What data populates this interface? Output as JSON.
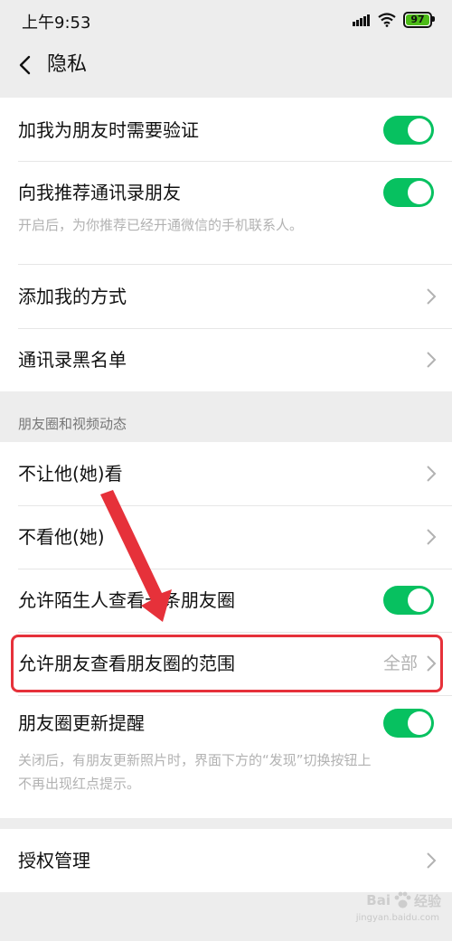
{
  "status_bar": {
    "time": "上午9:53",
    "battery": "97"
  },
  "nav": {
    "title": "隐私"
  },
  "group1": {
    "verify": {
      "label": "加我为朋友时需要验证"
    },
    "recommend": {
      "label": "向我推荐通讯录朋友",
      "desc": "开启后，为你推荐已经开通微信的手机联系人。"
    },
    "add_methods": {
      "label": "添加我的方式"
    },
    "blacklist": {
      "label": "通讯录黑名单"
    }
  },
  "moments_section": {
    "header": "朋友圈和视频动态",
    "hide_from": {
      "label": "不让他(她)看"
    },
    "dont_see": {
      "label": "不看他(她)"
    },
    "strangers": {
      "label": "允许陌生人查看十条朋友圈"
    },
    "range": {
      "label": "允许朋友查看朋友圈的范围",
      "value": "全部"
    },
    "update_reminder": {
      "label": "朋友圈更新提醒",
      "desc_line1": "关闭后，有朋友更新照片时，界面下方的“发现”切换按钮上",
      "desc_line2": "不再出现红点提示。"
    }
  },
  "group3": {
    "auth": {
      "label": "授权管理"
    }
  },
  "watermark": {
    "brand": "Bai",
    "brand2": "经验",
    "sub": "jingyan.baidu.com"
  },
  "colors": {
    "toggle_on": "#07c160",
    "annotation_red": "#e6313a"
  }
}
